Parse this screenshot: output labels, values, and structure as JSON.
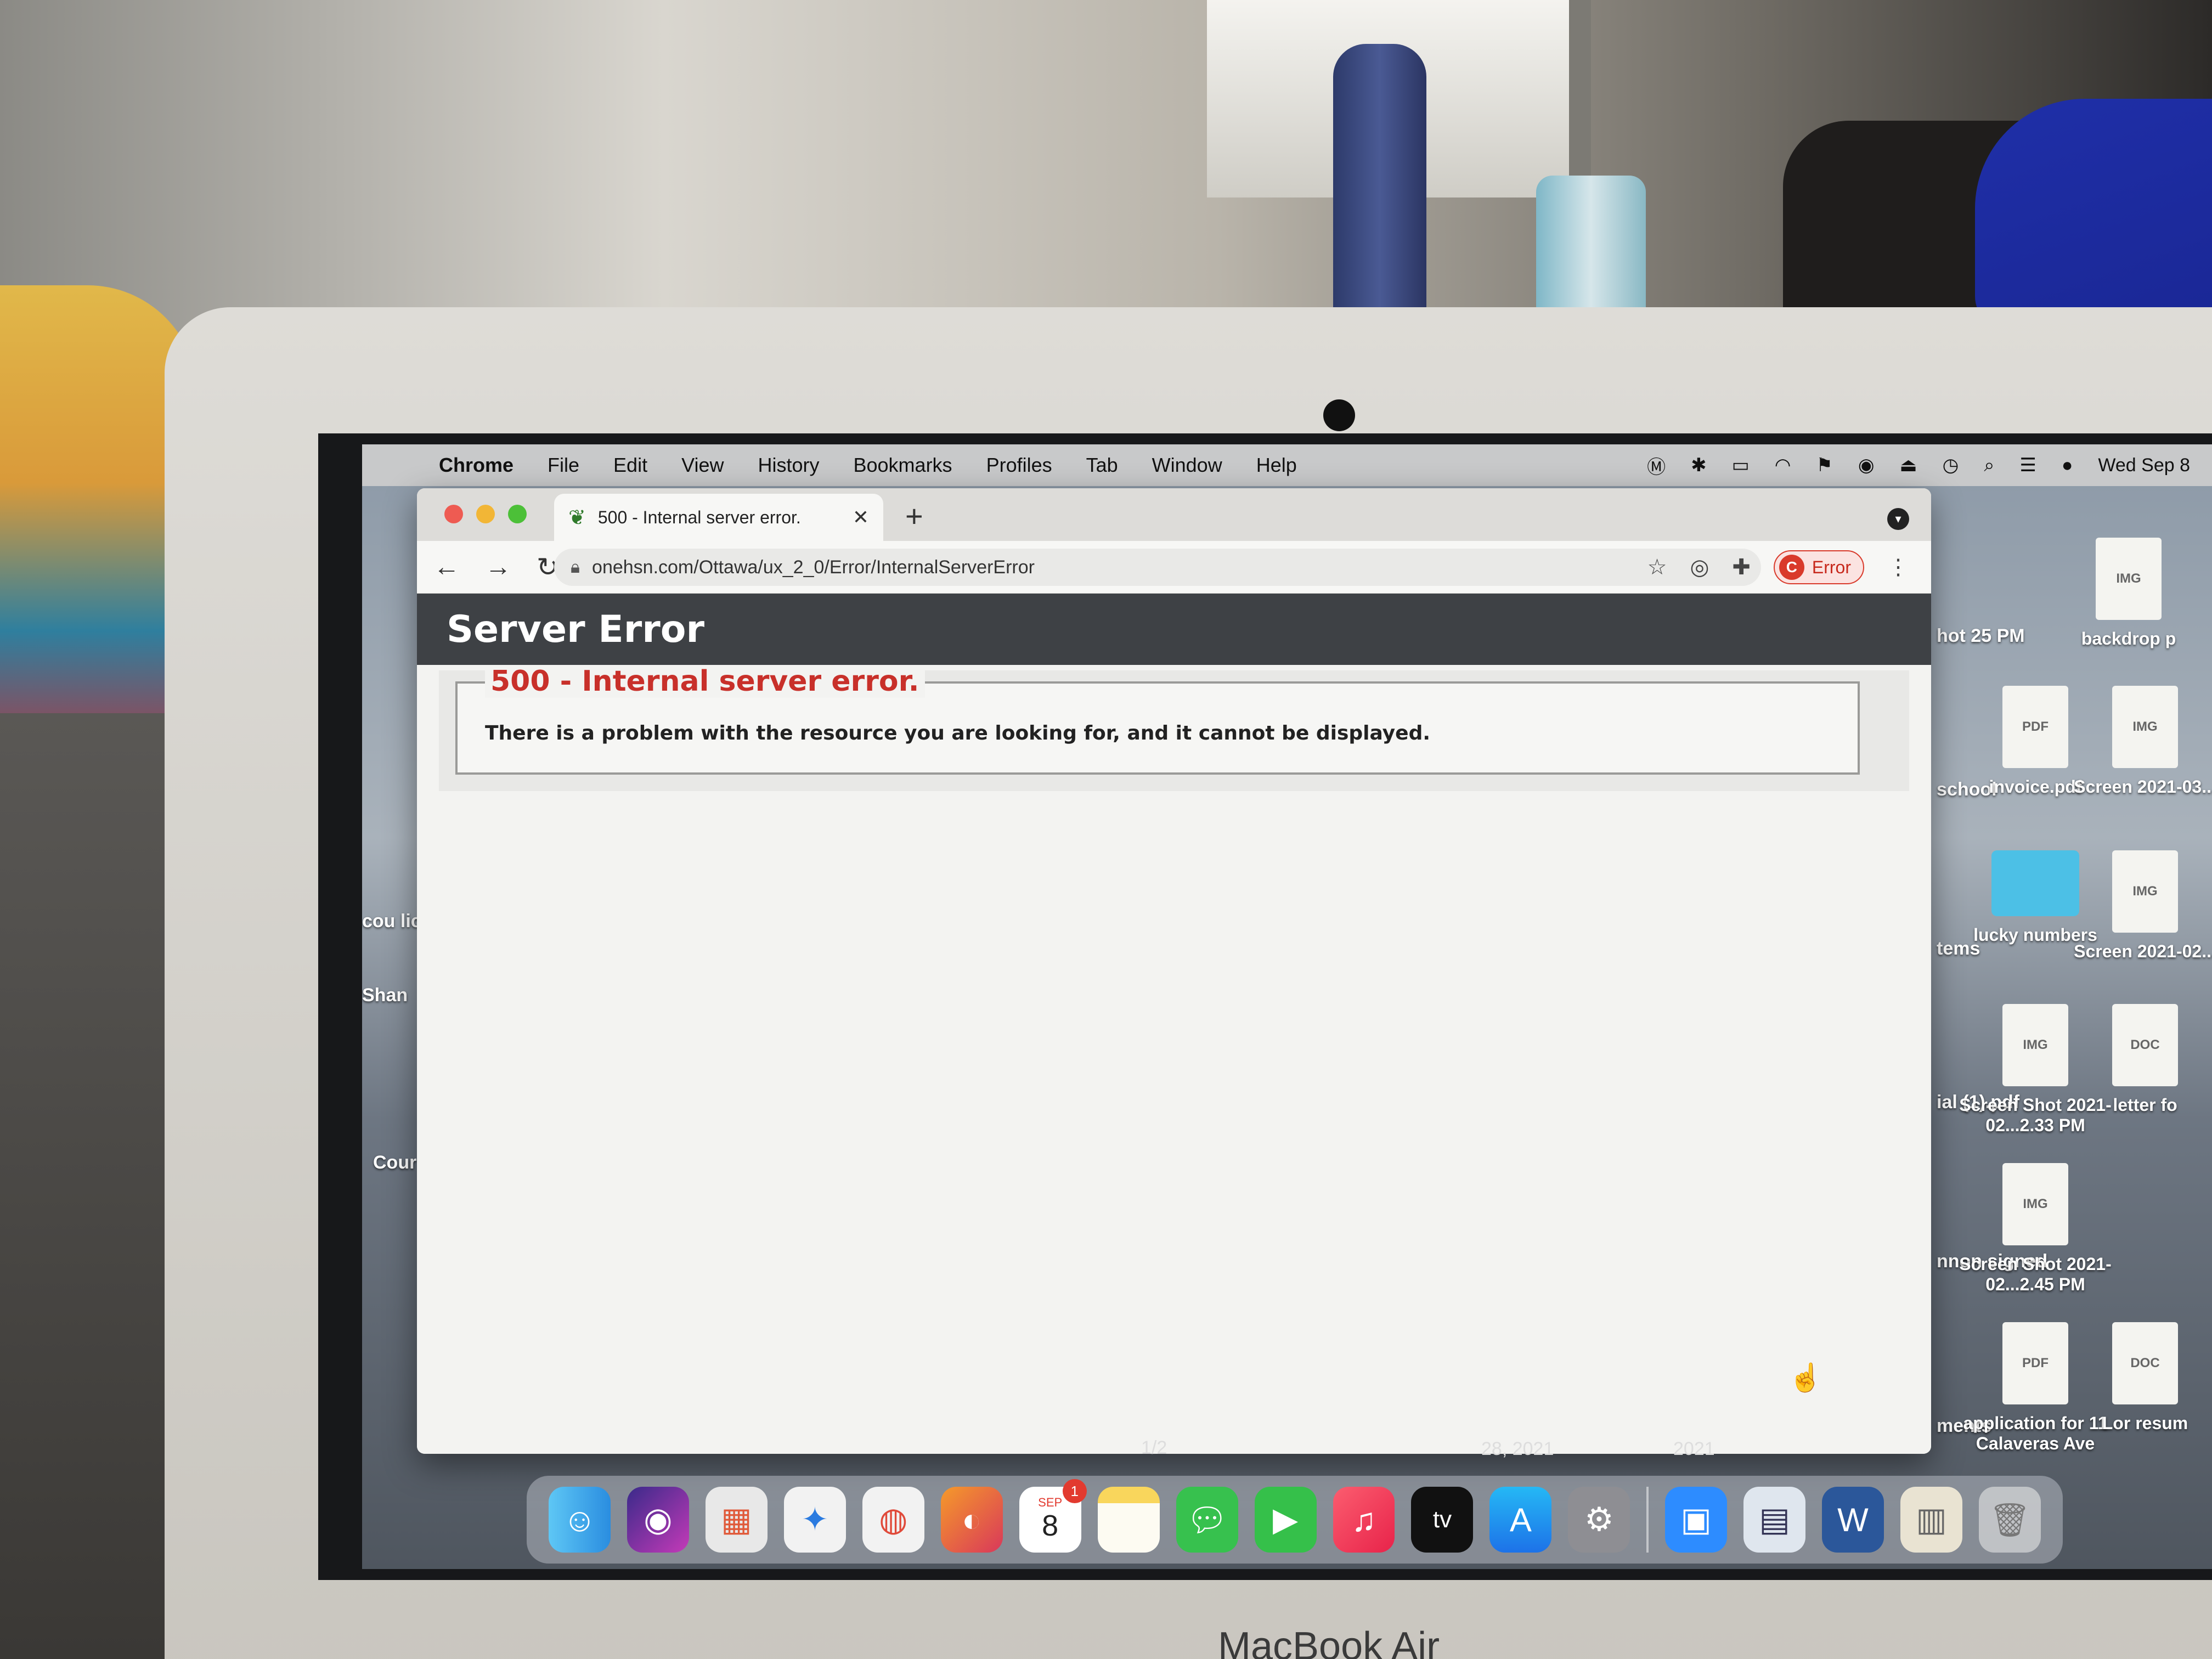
{
  "menubar": {
    "items": [
      "Chrome",
      "File",
      "Edit",
      "View",
      "History",
      "Bookmarks",
      "Profiles",
      "Tab",
      "Window",
      "Help"
    ],
    "clock": "Wed Sep 8"
  },
  "browser": {
    "tab_title": "500 - Internal server error.",
    "new_tab": "+",
    "url": "onehsn.com/Ottawa/ux_2_0/Error/InternalServerError",
    "error_chip_avatar": "C",
    "error_chip_label": "Error"
  },
  "page": {
    "header": "Server Error",
    "error_title": "500 - Internal server error.",
    "error_description": "There is a problem with the resource you are looking for, and it cannot be displayed."
  },
  "desktop": {
    "right_icons": [
      {
        "label": "backdrop p",
        "glyph": "IMG"
      },
      {
        "label": "invoice.pdf",
        "glyph": "PDF"
      },
      {
        "label": "Screen 2021-03...",
        "glyph": "IMG"
      },
      {
        "label": "lucky numbers",
        "glyph": "folder"
      },
      {
        "label": "Screen 2021-02...",
        "glyph": "IMG"
      },
      {
        "label": "Screen Shot 2021-02...2.33 PM",
        "glyph": "IMG"
      },
      {
        "label": "letter fo",
        "glyph": "DOC"
      },
      {
        "label": "Screen Shot 2021-02...2.45 PM",
        "glyph": "IMG"
      },
      {
        "label": "application for 11 Calaveras Ave",
        "glyph": "PDF"
      },
      {
        "label": "Lor resum",
        "glyph": "DOC"
      }
    ],
    "partial_labels": [
      "hot 25 PM",
      "school",
      "tems",
      "ial (1).pdf",
      "nnon signed",
      "ments"
    ],
    "left_labels": [
      "cou lic",
      "Shan",
      "Cour"
    ],
    "pager": "1/2",
    "date_a": "28, 2021",
    "date_b": "2021"
  },
  "dock": {
    "apps": [
      "finder",
      "siri",
      "launchpad",
      "safari",
      "chrome",
      "firefox",
      "calendar",
      "notes",
      "messages",
      "facetime",
      "music",
      "tv",
      "app-store",
      "system-preferences",
      "zoom",
      "preview",
      "word",
      "documents",
      "trash"
    ],
    "calendar_month": "SEP",
    "calendar_day": "8",
    "calendar_badge": "1",
    "tv_label": "tv"
  },
  "laptop_brand": "MacBook Air",
  "colors": {
    "error_red": "#c8302a",
    "header_dark": "#3e4145"
  }
}
